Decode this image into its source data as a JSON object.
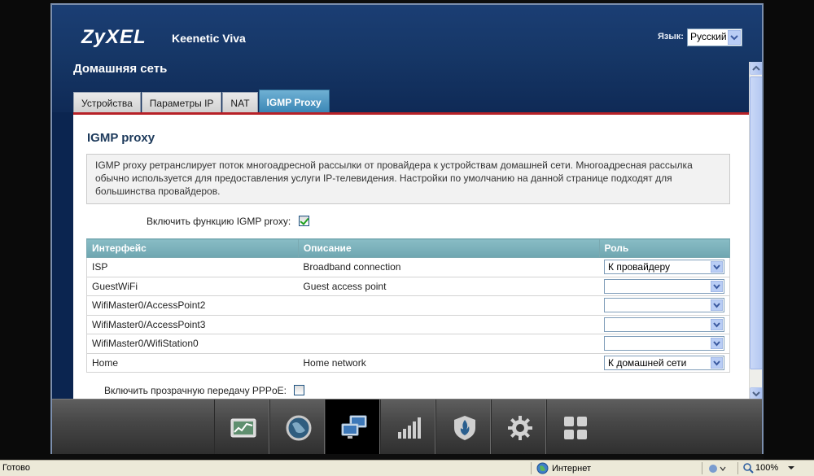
{
  "header": {
    "logo": "ZyXEL",
    "model": "Keenetic Viva",
    "language_label": "Язык:",
    "language_value": "Русский",
    "page_title": "Домашняя сеть"
  },
  "tabs": [
    {
      "label": "Устройства"
    },
    {
      "label": "Параметры IP"
    },
    {
      "label": "NAT"
    },
    {
      "label": "IGMP Proxy",
      "active": true
    }
  ],
  "section": {
    "title": "IGMP proxy",
    "description": "IGMP proxy ретранслирует поток многоадресной рассылки от провайдера к устройствам домашней сети. Многоадресная рассылка обычно используется для предоставления услуги IP-телевидения. Настройки по умолчанию на данной странице подходят для большинства провайдеров.",
    "enable_label": "Включить функцию IGMP proxy:",
    "enable_checked": true,
    "pppoe_label": "Включить прозрачную передачу PPPoE:",
    "pppoe_checked": false
  },
  "table": {
    "columns": [
      "Интерфейс",
      "Описание",
      "Роль"
    ],
    "rows": [
      {
        "interface": "ISP",
        "description": "Broadband connection",
        "role": "К провайдеру"
      },
      {
        "interface": "GuestWiFi",
        "description": "Guest access point",
        "role": ""
      },
      {
        "interface": "WifiMaster0/AccessPoint2",
        "description": "",
        "role": ""
      },
      {
        "interface": "WifiMaster0/AccessPoint3",
        "description": "",
        "role": ""
      },
      {
        "interface": "WifiMaster0/WifiStation0",
        "description": "",
        "role": ""
      },
      {
        "interface": "Home",
        "description": "Home network",
        "role": "К домашней сети"
      }
    ]
  },
  "nav": [
    {
      "icon": "monitor-chart-icon"
    },
    {
      "icon": "globe-icon"
    },
    {
      "icon": "network-computers-icon",
      "active": true
    },
    {
      "icon": "wifi-signal-bars-icon"
    },
    {
      "icon": "shield-icon"
    },
    {
      "icon": "gear-icon"
    },
    {
      "icon": "apps-grid-icon"
    }
  ],
  "statusbar": {
    "ready": "Готово",
    "zone": "Интернет",
    "zoom": "100%"
  },
  "colors": {
    "header_bg": "#163767",
    "tab_active": "#3784b4",
    "accent_line": "#b72127",
    "table_header": "#7fb3bc"
  }
}
